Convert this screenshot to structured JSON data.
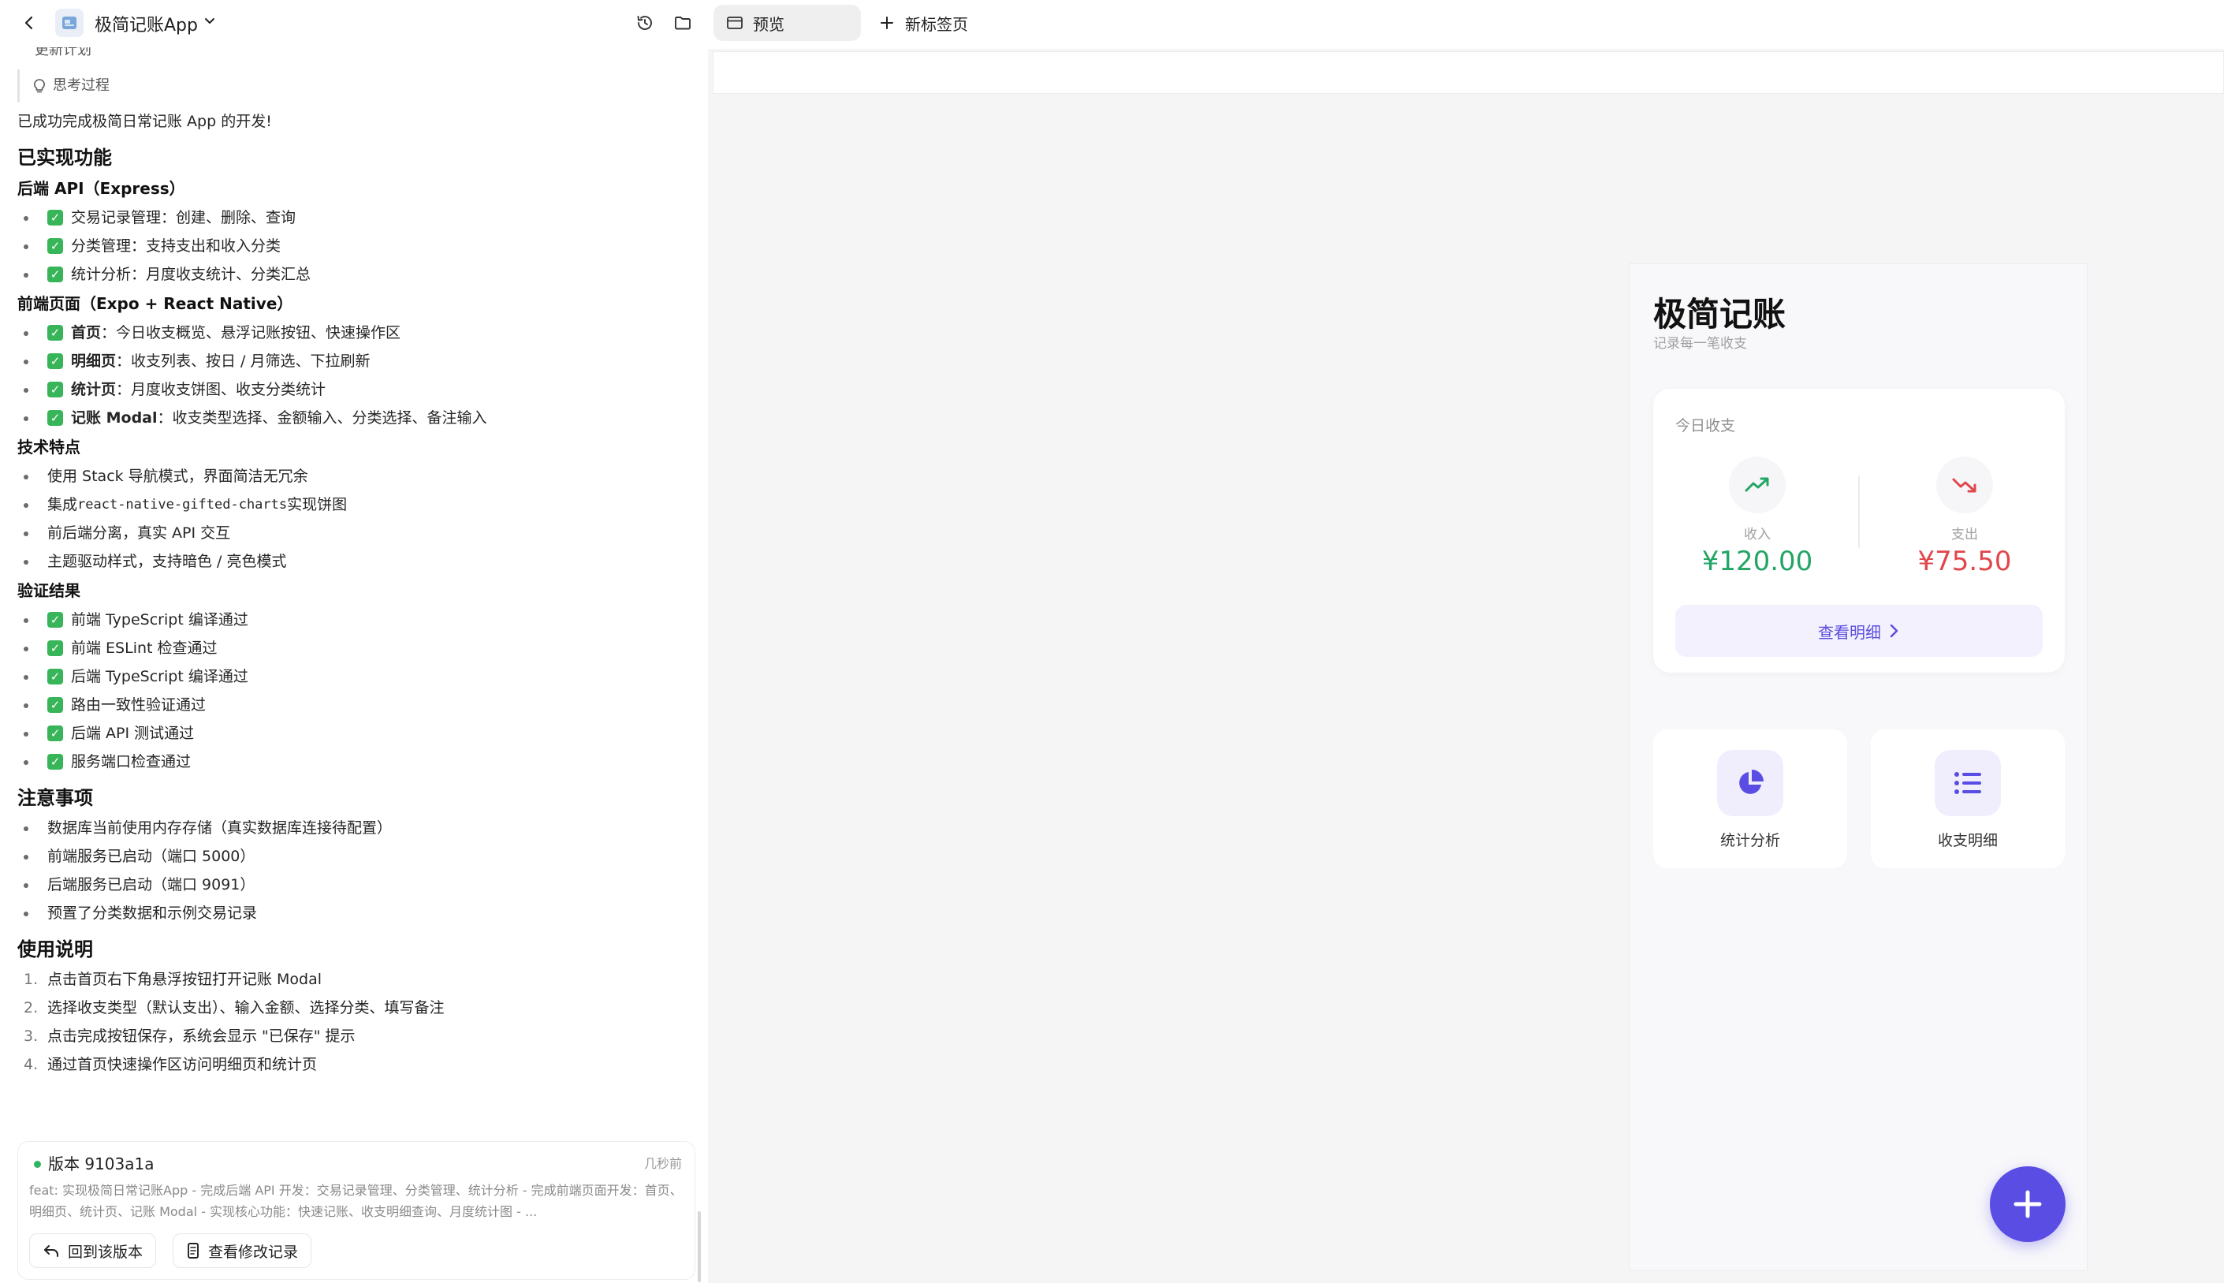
{
  "header": {
    "app_title": "极简记账App"
  },
  "chat": {
    "cut_off_item": "更新计划",
    "thinking_label": "思考过程",
    "intro": "已成功完成极简日常记账 App 的开发!",
    "sections": {
      "implemented_title": "已实现功能",
      "backend_title": "后端 API（Express）",
      "backend_items": [
        "交易记录管理：创建、删除、查询",
        "分类管理：支持支出和收入分类",
        "统计分析：月度收支统计、分类汇总"
      ],
      "frontend_title": "前端页面（Expo + React Native）",
      "frontend_items": [
        {
          "bold": "首页",
          "rest": "：今日收支概览、悬浮记账按钮、快速操作区"
        },
        {
          "bold": "明细页",
          "rest": "：收支列表、按日 / 月筛选、下拉刷新"
        },
        {
          "bold": "统计页",
          "rest": "：月度收支饼图、收支分类统计"
        },
        {
          "bold": "记账 Modal",
          "rest": "：收支类型选择、金额输入、分类选择、备注输入"
        }
      ],
      "tech_title": "技术特点",
      "tech_items": [
        {
          "pre": "使用 Stack 导航模式，界面简洁无冗余",
          "code": "",
          "post": ""
        },
        {
          "pre": "集成 ",
          "code": "react-native-gifted-charts",
          "post": " 实现饼图"
        },
        {
          "pre": "前后端分离，真实 API 交互",
          "code": "",
          "post": ""
        },
        {
          "pre": "主题驱动样式，支持暗色 / 亮色模式",
          "code": "",
          "post": ""
        }
      ],
      "verify_title": "验证结果",
      "verify_items": [
        "前端 TypeScript 编译通过",
        "前端 ESLint 检查通过",
        "后端 TypeScript 编译通过",
        "路由一致性验证通过",
        "后端 API 测试通过",
        "服务端口检查通过"
      ],
      "notes_title": "注意事项",
      "notes_items": [
        "数据库当前使用内存存储（真实数据库连接待配置）",
        "前端服务已启动（端口 5000）",
        "后端服务已启动（端口 9091）",
        "预置了分类数据和示例交易记录"
      ],
      "usage_title": "使用说明",
      "usage_items": [
        {
          "num": "1.",
          "text": "点击首页右下角悬浮按钮打开记账 Modal"
        },
        {
          "num": "2.",
          "text": "选择收支类型（默认支出）、输入金额、选择分类、填写备注"
        },
        {
          "num": "3.",
          "text": "点击完成按钮保存，系统会显示 \"已保存\" 提示"
        },
        {
          "num": "4.",
          "text": "通过首页快速操作区访问明细页和统计页"
        }
      ]
    }
  },
  "version_card": {
    "title": "版本 9103a1a",
    "time": "几秒前",
    "message": "feat: 实现极简日常记账App - 完成后端 API 开发：交易记录管理、分类管理、统计分析 - 完成前端页面开发：首页、明细页、统计页、记账 Modal - 实现核心功能：快速记账、收支明细查询、月度统计图 - ...",
    "revert_label": "回到该版本",
    "changes_label": "查看修改记录"
  },
  "tabs": {
    "active_label": "预览",
    "new_tab_label": "新标签页"
  },
  "app_preview": {
    "title": "极简记账",
    "subtitle": "记录每一笔收支",
    "today_label": "今日收支",
    "income_label": "收入",
    "income_amount": "¥120.00",
    "expense_label": "支出",
    "expense_amount": "¥75.50",
    "detail_button": "查看明细",
    "quick_actions": [
      {
        "label": "统计分析",
        "icon": "pie-chart-icon"
      },
      {
        "label": "收支明细",
        "icon": "list-icon"
      }
    ],
    "colors": {
      "accent": "#5a4de3",
      "income": "#22a565",
      "expense": "#e0474c"
    }
  }
}
